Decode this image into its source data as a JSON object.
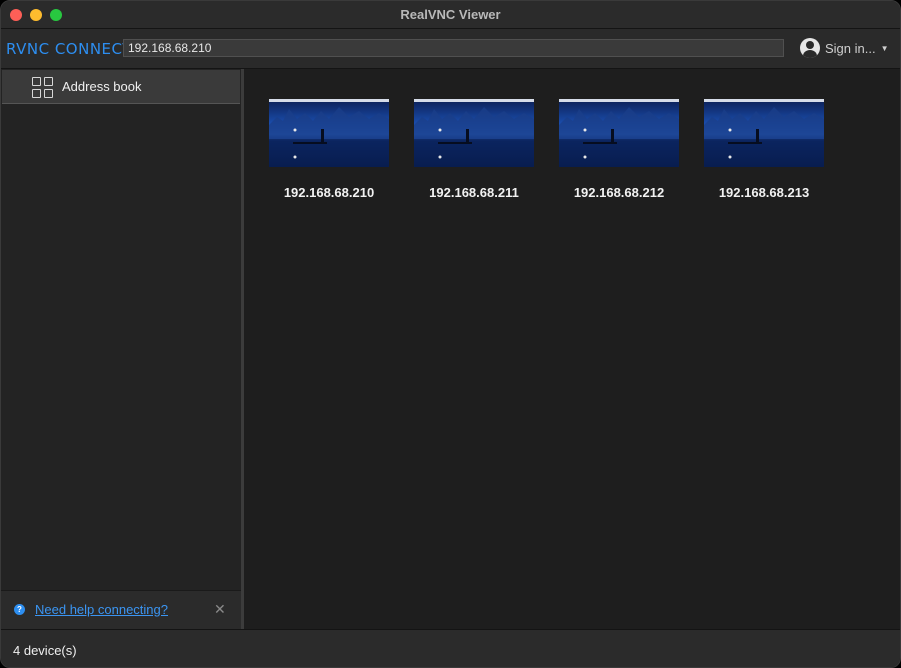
{
  "window": {
    "title": "RealVNC Viewer"
  },
  "toolbar": {
    "logo_text": "RVNC CONNECT",
    "address_value": "192.168.68.210",
    "signin_label": "Sign in...",
    "accent": "#2d8ef0"
  },
  "sidebar": {
    "items": [
      {
        "label": "Address book",
        "icon": "grid-icon"
      }
    ],
    "help_link": "Need help connecting?"
  },
  "devices": [
    {
      "label": "192.168.68.210"
    },
    {
      "label": "192.168.68.211"
    },
    {
      "label": "192.168.68.212"
    },
    {
      "label": "192.168.68.213"
    }
  ],
  "status": {
    "text": "4 device(s)"
  }
}
